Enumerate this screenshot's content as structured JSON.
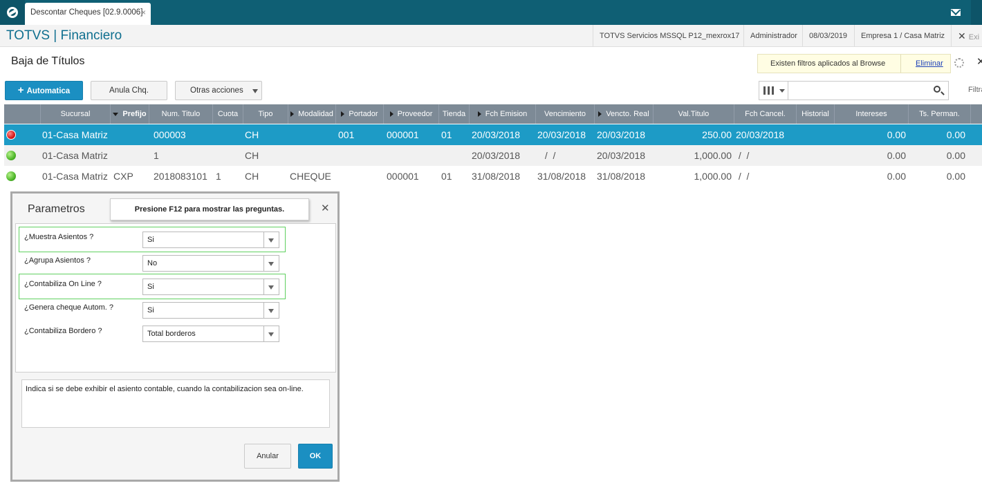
{
  "tab": {
    "title": "Descontar Cheques [02.9.0006]",
    "close": "×"
  },
  "header": {
    "brand": "TOTVS | Financiero",
    "server": "TOTVS Servicios MSSQL P12_mexrox17",
    "user": "Administrador",
    "date": "08/03/2019",
    "company": "Empresa 1 / Casa Matriz",
    "close_label": "Exi"
  },
  "page": {
    "title": "Baja de Títulos"
  },
  "filter_note": {
    "text": "Existen filtros aplicados al Browse",
    "remove": "Eliminar"
  },
  "toolbar": {
    "automatica": "Automatica",
    "anula": "Anula Chq.",
    "otras": "Otras acciones",
    "filtrar": "Filtrar"
  },
  "grid": {
    "columns": [
      "Sucursal",
      "Prefijo",
      "Num. Titulo",
      "Cuota",
      "Tipo",
      "Modalidad",
      "Portador",
      "Proveedor",
      "Tienda",
      "Fch Emision",
      "Vencimiento",
      "Vencto. Real",
      "Val.Titulo",
      "Fch Cancel.",
      "Historial",
      "Intereses",
      "Ts. Perman."
    ],
    "rows": [
      {
        "status": "red",
        "sucursal": "01-Casa Matriz",
        "prefijo": "",
        "num": "000003",
        "cuota": "",
        "tipo": "CH",
        "modalidad": "",
        "portador": "001",
        "proveedor": "000001",
        "tienda": "01",
        "emision": "20/03/2018",
        "vencimiento": "20/03/2018",
        "vencto_real": "20/03/2018",
        "valor": "250.00",
        "cancel": "20/03/2018",
        "intereses": "0.00",
        "perman": "0.00"
      },
      {
        "status": "green",
        "sucursal": "01-Casa Matriz",
        "prefijo": "",
        "num": "1",
        "cuota": "",
        "tipo": "CH",
        "modalidad": "",
        "portador": "",
        "proveedor": "",
        "tienda": "",
        "emision": "20/03/2018",
        "vencimiento": " /  /",
        "vencto_real": "20/03/2018",
        "valor": "1,000.00",
        "cancel": " /  /",
        "intereses": "0.00",
        "perman": "0.00"
      },
      {
        "status": "green",
        "sucursal": "01-Casa Matriz",
        "prefijo": "CXP",
        "num": "2018083101",
        "cuota": "1",
        "tipo": "CH",
        "modalidad": "CHEQUE",
        "portador": "",
        "proveedor": "000001",
        "tienda": "01",
        "emision": "31/08/2018",
        "vencimiento": "31/08/2018",
        "vencto_real": "31/08/2018",
        "valor": "1,000.00",
        "cancel": " /  /",
        "intereses": "0.00",
        "perman": "0.00"
      }
    ]
  },
  "dialog": {
    "title": "Parametros",
    "hint": "Presione F12 para mostrar las preguntas.",
    "questions": [
      {
        "label": "¿Muestra Asientos ?",
        "value": "Si"
      },
      {
        "label": "¿Agrupa Asientos ?",
        "value": "No"
      },
      {
        "label": "¿Contabiliza On Line ?",
        "value": "Si"
      },
      {
        "label": "¿Genera cheque Autom. ?",
        "value": "Si"
      },
      {
        "label": "¿Contabiliza Bordero ?",
        "value": "Total borderos"
      }
    ],
    "description": "Indica si se debe exhibir el asiento contable, cuando la contabilizacion sea on-line.",
    "cancel": "Anular",
    "ok": "OK"
  },
  "colors": {
    "accent": "#1b8fc2",
    "topbar": "#0f5f74",
    "grid_header": "#7d8a96",
    "highlight": "#5fd05f"
  }
}
